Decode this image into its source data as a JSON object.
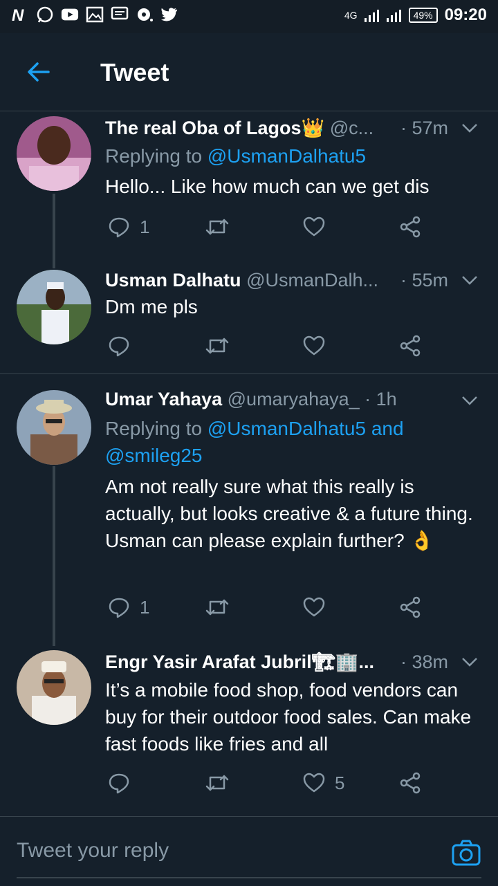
{
  "status_bar": {
    "battery": "49%",
    "time": "09:20",
    "network": "4G"
  },
  "header": {
    "title": "Tweet"
  },
  "tweets": [
    {
      "name": "The real Oba of Lagos👑",
      "handle": "@c...",
      "time": "· 57m",
      "replying_prefix": "Replying to ",
      "replying_to": "@UsmanDalhatu5",
      "text": "Hello... Like how much can we get dis",
      "replies": "1",
      "likes": ""
    },
    {
      "name": "Usman Dalhatu",
      "handle": "@UsmanDalh...",
      "time": "· 55m",
      "text": "Dm me pls",
      "replies": "",
      "likes": ""
    },
    {
      "name": "Umar Yahaya",
      "handle": "@umaryahaya_",
      "time": "· 1h",
      "replying_prefix": "Replying to ",
      "replying_to": "@UsmanDalhatu5 and @smileg25",
      "text": "Am not really sure what this really is actually, but looks creative & a future thing. Usman can please explain further? 👌",
      "replies": "1",
      "likes": ""
    },
    {
      "name": "Engr Yasir Arafat Jubril🏗🏢...",
      "handle": "",
      "time": "· 38m",
      "text": "It’s a mobile food shop, food vendors can buy for their outdoor food sales. Can make fast foods like fries and all",
      "replies": "",
      "likes": "5"
    }
  ],
  "composer": {
    "placeholder": "Tweet your reply"
  },
  "colors": {
    "background": "#15202b",
    "accent": "#1da1f2",
    "muted": "#8899a6",
    "divider": "#38444d"
  }
}
